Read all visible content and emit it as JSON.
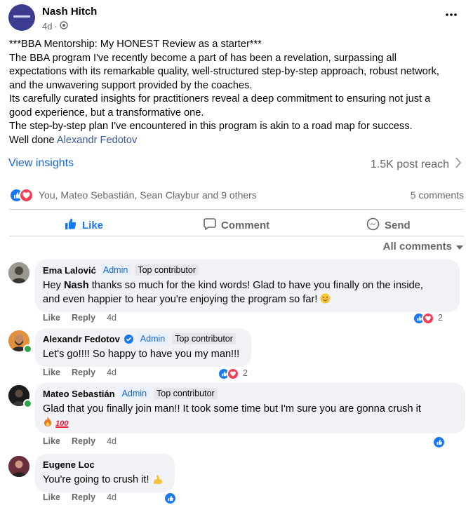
{
  "post": {
    "author": "Nash Hitch",
    "age": "4d",
    "meta_separator": "·",
    "more_icon": "more-horizontal-icon",
    "lines": [
      "***BBA Mentorship: My HONEST Review as a starter***",
      "The BBA program I've recently become a part of has been a revelation, surpassing all",
      "expectations with its remarkable quality, well-structured step-by-step approach, robust network,",
      "and the unwavering support provided by the coaches.",
      "Its carefully curated insights for practitioners reveal a deep commitment to ensuring not just a",
      "good experience, but a transformative one.",
      "The step-by-step plan I've encountered in this program is akin to a road map for success."
    ],
    "last_line_prefix": "Well done",
    "mention": "Alexandr Fedotov",
    "insights_label": "View insights",
    "reach": "1.5K post reach",
    "reactions_text": "You, Mateo Sebastián, Sean Claybur and 9 others",
    "comments_count": "5 comments"
  },
  "actions": {
    "like": "Like",
    "comment": "Comment",
    "send": "Send"
  },
  "filter": {
    "label": "All comments"
  },
  "comments": [
    {
      "author": "Ema Lalović",
      "badge_admin": "Admin",
      "badge_top": "Top contributor",
      "body_prefix": "Hey ",
      "body_bold": "Nash",
      "body_line1_rest": " thanks so much for the kind words! Glad to have you finally on the inside,",
      "body_line2": "and even happier to hear you're enjoying the program so far!",
      "like": "Like",
      "reply": "Reply",
      "age": "4d",
      "reaction_count": "2"
    },
    {
      "author": "Alexandr Fedotov",
      "badge_admin": "Admin",
      "badge_top": "Top contributor",
      "body": "Let's go!!!! So happy to have you my man!!!",
      "like": "Like",
      "reply": "Reply",
      "age": "4d",
      "reaction_count": "2"
    },
    {
      "author": "Mateo Sebastián",
      "badge_admin": "Admin",
      "badge_top": "Top contributor",
      "body": "Glad that you finally join man!! It took some time but I'm sure you are gonna crush it",
      "emoji_hundred": "100",
      "like": "Like",
      "reply": "Reply",
      "age": "4d"
    },
    {
      "author": "Eugene Loc",
      "body": "You're going to crush it!",
      "like": "Like",
      "reply": "Reply",
      "age": "4d"
    }
  ],
  "colors": {
    "link": "#1b64d6",
    "like_blue": "#1877f2",
    "love_red": "#f33e58",
    "bubble": "#f0f2f5",
    "muted": "#65676b"
  }
}
